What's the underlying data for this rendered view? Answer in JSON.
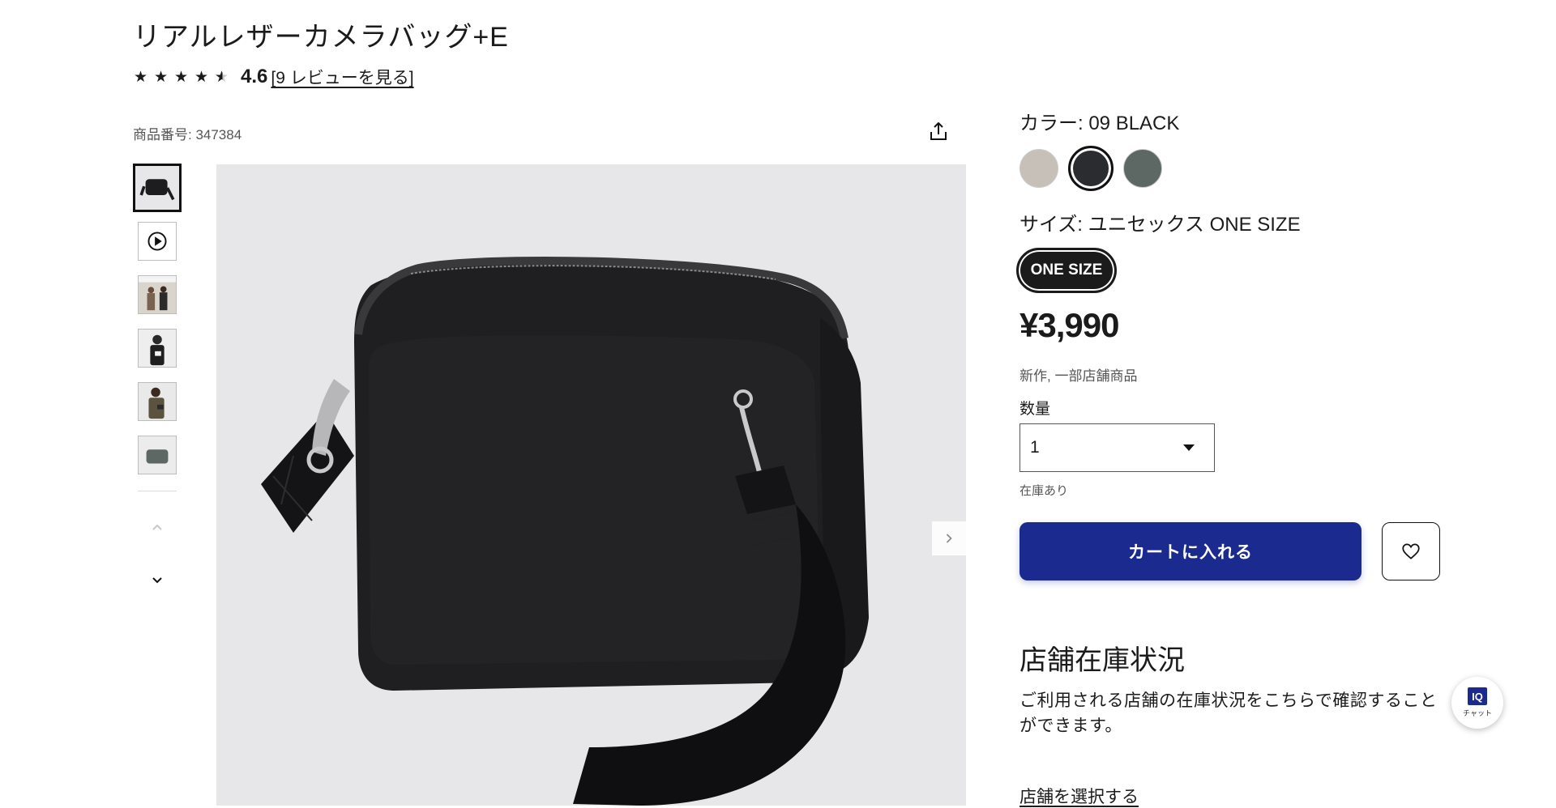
{
  "product": {
    "title": "リアルレザーカメラバッグ+E",
    "rating_value": "4.6",
    "stars_full": 4,
    "stars_half": 1,
    "review_link": "[9 レビューを見る]",
    "product_number": "商品番号: 347384"
  },
  "gallery": {
    "thumbnails": [
      "bag-black",
      "video",
      "lifestyle-pair",
      "model-white",
      "model-olive",
      "bag-green"
    ],
    "active_index": 0
  },
  "options": {
    "color_label": "カラー:  09 BLACK",
    "colors": [
      "#c7c0b8",
      "#2b2c30",
      "#5d6864"
    ],
    "selected_color_index": 1,
    "size_label": "サイズ:  ユニセックス ONE SIZE",
    "size_chip": "ONE SIZE",
    "price": "¥3,990",
    "tags": "新作, 一部店舗商品",
    "quantity_label": "数量",
    "quantity_value": "1",
    "stock_status": "在庫あり",
    "add_to_cart": "カートに入れる"
  },
  "store_stock": {
    "heading": "店舗在庫状況",
    "description": "ご利用される店舗の在庫状況をこちらで確認することができます。",
    "link": "店舗を選択する"
  },
  "chat": {
    "logo": "IQ",
    "label": "チャット"
  },
  "colors": {
    "cart_button": "#1b2a8f",
    "text": "#1b1b1b"
  }
}
